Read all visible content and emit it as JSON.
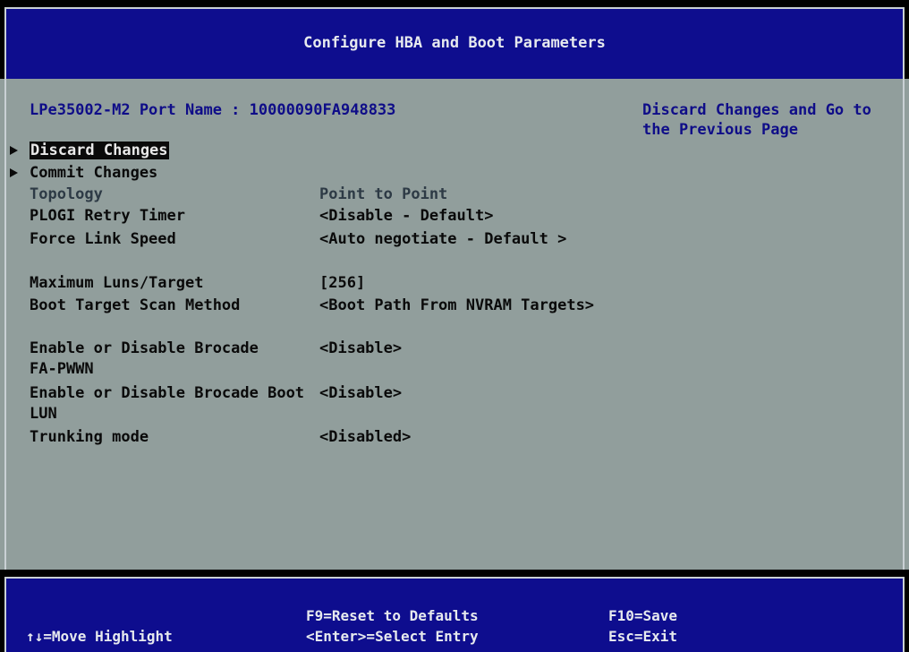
{
  "title": "Configure HBA and Boot Parameters",
  "port": {
    "label": "LPe35002-M2 Port Name : 10000090FA948833"
  },
  "help_text": "Discard Changes and Go to the Previous Page",
  "actions": [
    {
      "label": "Discard Changes",
      "selected": true
    },
    {
      "label": "Commit  Changes",
      "selected": false
    }
  ],
  "settings": {
    "topology": {
      "label": "Topology",
      "value": "Point to Point",
      "editable": false
    },
    "plogi": {
      "label": "PLOGI Retry Timer",
      "value": "<Disable - Default>"
    },
    "link_speed": {
      "label": "Force Link Speed",
      "value": "<Auto negotiate - Default >"
    },
    "max_luns": {
      "label": "Maximum Luns/Target",
      "value": "[256]"
    },
    "boot_scan": {
      "label": "Boot Target Scan Method",
      "value": "<Boot Path From NVRAM Targets>"
    },
    "fa_pwwn": {
      "label_line1": "Enable or Disable Brocade",
      "label_line2": "FA-PWWN",
      "value": "<Disable>"
    },
    "boot_lun": {
      "label_line1": "Enable or Disable Brocade Boot",
      "label_line2": "LUN",
      "value": "<Disable>"
    },
    "trunking": {
      "label": "Trunking mode",
      "value": "<Disabled>"
    }
  },
  "footer": {
    "move": "↑↓=Move Highlight",
    "reset": "F9=Reset to Defaults",
    "select": "<Enter>=Select Entry",
    "save": "F10=Save",
    "exit": "Esc=Exit"
  },
  "colors": {
    "background": "#919e9c",
    "title_bar": "#0e0d8e",
    "header_text": "#0f0d88",
    "highlight": "#0a0a0a"
  }
}
